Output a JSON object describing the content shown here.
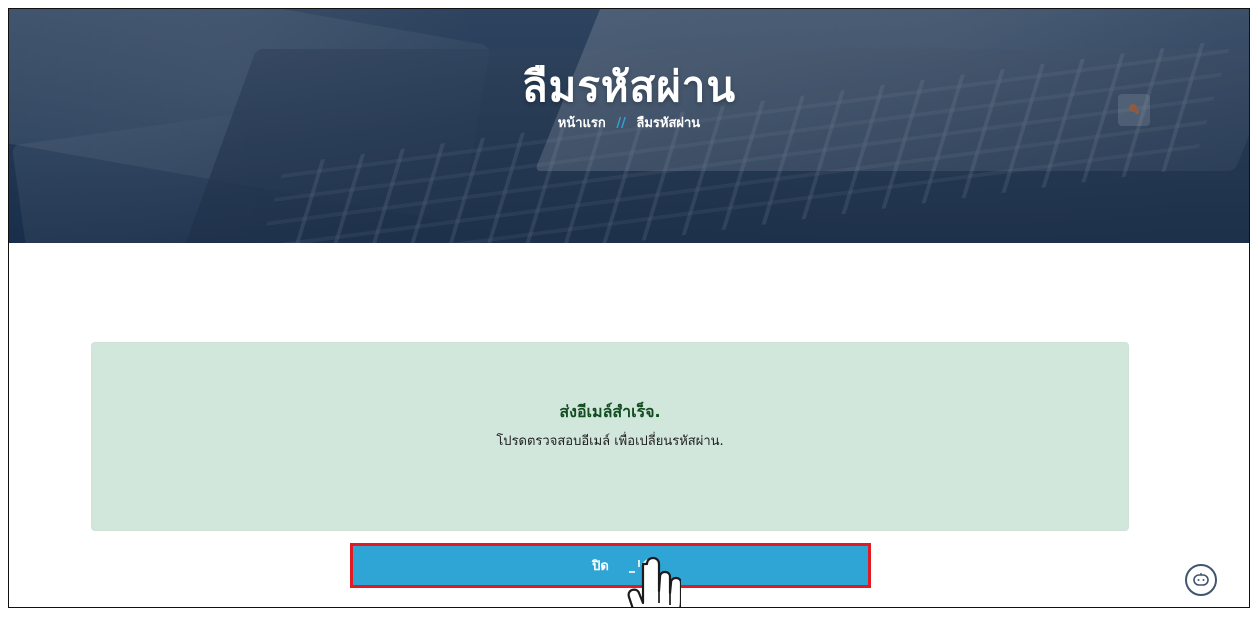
{
  "header": {
    "title": "ลืมรหัสผ่าน",
    "breadcrumb_home": "หน้าแรก",
    "breadcrumb_separator": "//",
    "breadcrumb_current": "ลืมรหัสผ่าน"
  },
  "success": {
    "title": "ส่งอีเมล์สำเร็จ.",
    "message": "โปรดตรวจสอบอีเมล์ เพื่อเปลี่ยนรหัสผ่าน."
  },
  "actions": {
    "close_label": "ปิด"
  },
  "icons": {
    "search": "search-icon",
    "pointer": "hand-pointer-icon",
    "chat": "chatbot-icon"
  },
  "colors": {
    "hero_overlay": "#2d4461",
    "breadcrumb_separator": "#2ea7d6",
    "success_background": "#d2e7dc",
    "success_title": "#114d21",
    "button_background": "#2fa5d5",
    "button_highlight": "#e01b24"
  }
}
